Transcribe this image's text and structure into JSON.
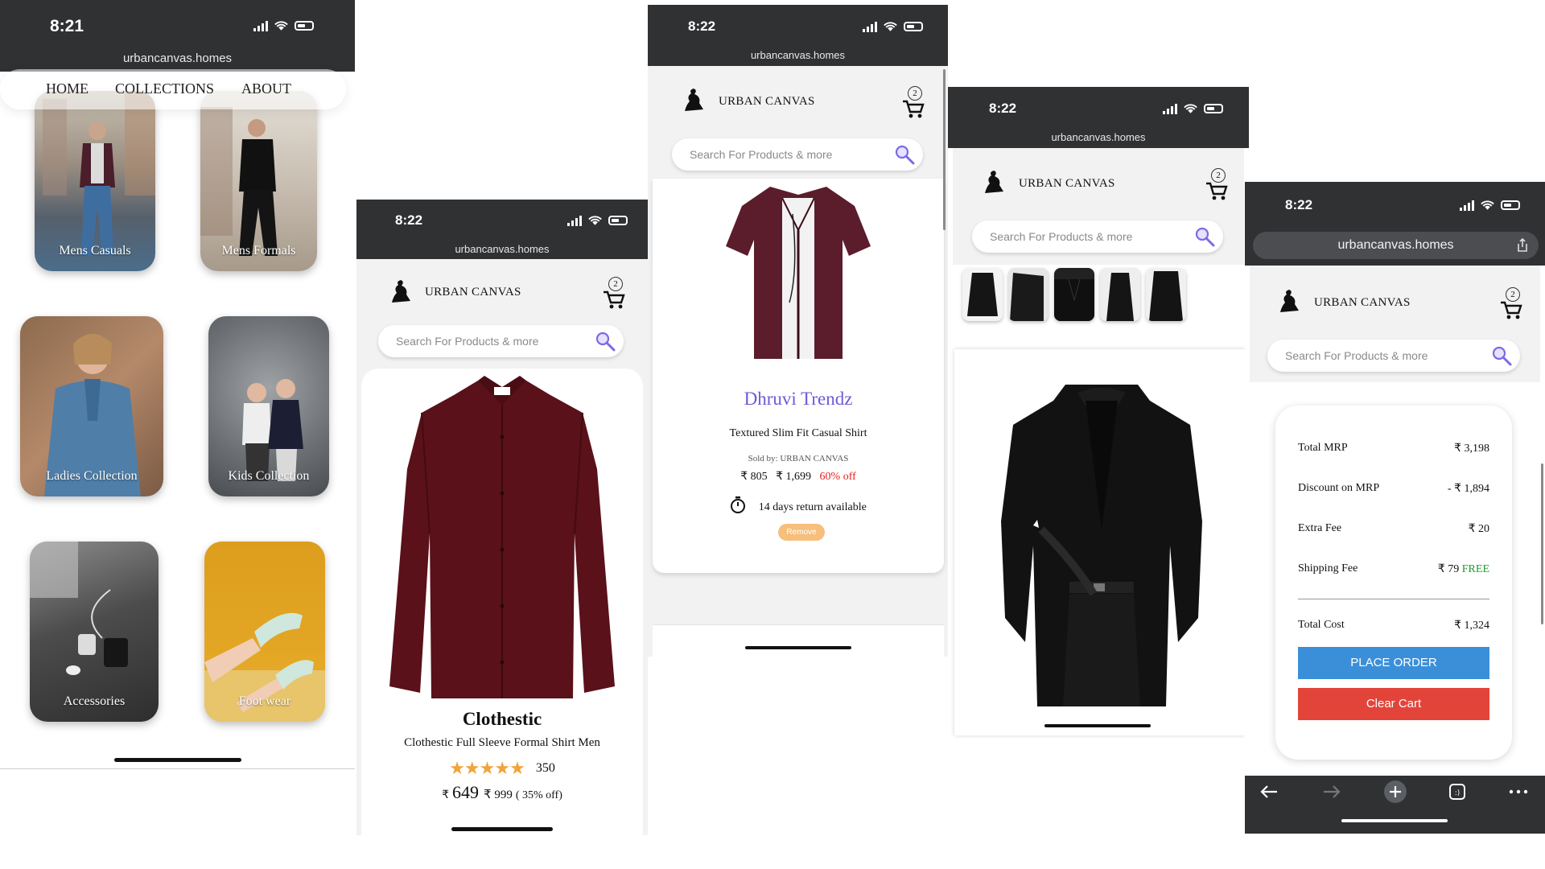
{
  "status": {
    "time_1": "8:21",
    "time_2": "8:22",
    "url": "urbancanvas.homes"
  },
  "brand": {
    "name": "URBAN CANVAS",
    "cart_count": "2"
  },
  "search": {
    "placeholder": "Search For Products & more"
  },
  "home": {
    "nav": [
      "HOME",
      "COLLECTIONS",
      "ABOUT"
    ],
    "tiles": [
      "Mens Casuals",
      "Mens Formals",
      "Ladies Collection",
      "Kids Collection",
      "Accessories",
      "Foot wear"
    ]
  },
  "product": {
    "brand": "Clothestic",
    "title": "Clothestic Full Sleeve Formal Shirt Men",
    "rating_count": "350",
    "rating": 5,
    "currency": "₹",
    "price": "649",
    "mrp": "₹ 999",
    "discount": "( 35% off)"
  },
  "cart_item": {
    "brand": "Dhruvi Trendz",
    "title": "Textured Slim Fit Casual Shirt",
    "seller": "Sold by: URBAN CANVAS",
    "price": "₹ 805",
    "mrp": "₹ 1,699",
    "off": "60% off",
    "return": "14 days return available",
    "remove": "Remove"
  },
  "summary": {
    "rows": [
      {
        "label": "Total MRP",
        "value": "₹ 3,198"
      },
      {
        "label": "Discount on MRP",
        "value": "- ₹ 1,894"
      },
      {
        "label": "Extra Fee",
        "value": "₹ 20"
      },
      {
        "label": "Shipping Fee",
        "value": "₹ 79",
        "extra": "FREE"
      }
    ],
    "total_label": "Total Cost",
    "total_value": "₹ 1,324",
    "place_order": "PLACE ORDER",
    "clear_cart": "Clear Cart"
  },
  "colors": {
    "statusbar": "#2f3133",
    "accent_purple": "#6b5bd6",
    "discount_red": "#e5201e",
    "free_green": "#1e9a2c",
    "place_order_blue": "#3b8fd9",
    "clear_cart_red": "#e3443a",
    "remove_orange": "#f6bf7c"
  }
}
